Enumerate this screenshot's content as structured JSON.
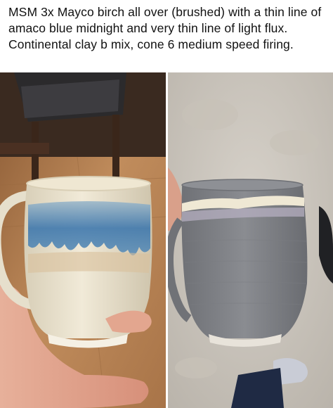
{
  "post": {
    "caption": "MSM 3x Mayco birch all over (brushed) with a thin line of amaco blue midnight and very thin line of light flux. Continental clay b mix, cone 6 medium speed firing."
  },
  "photos": [
    {
      "subject": "fired-mug",
      "colors": {
        "glaze": "#e9e2cf",
        "drip": "#3f78ad",
        "floor": "#b8865a"
      }
    },
    {
      "subject": "unfired-mug",
      "colors": {
        "clay": "#808287",
        "glaze_line": "#efe8d4",
        "floor": "#cfcac2"
      }
    }
  ]
}
